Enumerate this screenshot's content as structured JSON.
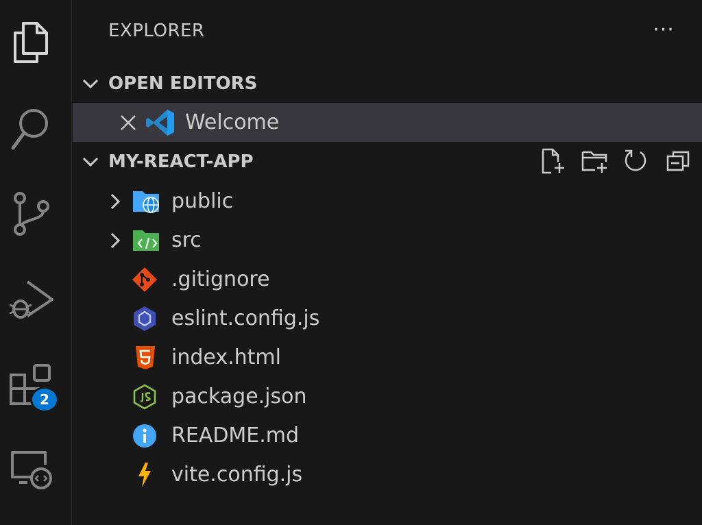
{
  "activity_bar": {
    "items": [
      {
        "icon": "files-icon"
      },
      {
        "icon": "search-icon"
      },
      {
        "icon": "source-control-icon"
      },
      {
        "icon": "run-debug-icon"
      },
      {
        "icon": "extensions-icon",
        "badge": "2"
      },
      {
        "icon": "remote-explorer-icon"
      }
    ],
    "badge_color": "#0078d4"
  },
  "sidebar": {
    "title": "EXPLORER",
    "more_label": "···",
    "open_editors": {
      "label": "OPEN EDITORS",
      "items": [
        {
          "name": "Welcome",
          "icon": "vscode-icon"
        }
      ]
    },
    "project": {
      "label": "MY-REACT-APP",
      "toolbar": [
        "new-file-icon",
        "new-folder-icon",
        "refresh-icon",
        "collapse-all-icon"
      ],
      "items": [
        {
          "name": "public",
          "type": "folder",
          "icon": "folder-public-icon"
        },
        {
          "name": "src",
          "type": "folder",
          "icon": "folder-src-icon"
        },
        {
          "name": ".gitignore",
          "type": "file",
          "icon": "git-icon"
        },
        {
          "name": "eslint.config.js",
          "type": "file",
          "icon": "eslint-icon"
        },
        {
          "name": "index.html",
          "type": "file",
          "icon": "html5-icon"
        },
        {
          "name": "package.json",
          "type": "file",
          "icon": "nodejs-icon"
        },
        {
          "name": "README.md",
          "type": "file",
          "icon": "info-icon"
        },
        {
          "name": "vite.config.js",
          "type": "file",
          "icon": "vite-icon"
        }
      ]
    }
  },
  "colors": {
    "background": "#181818",
    "selected_row": "#37373d",
    "text": "#cccccc"
  }
}
